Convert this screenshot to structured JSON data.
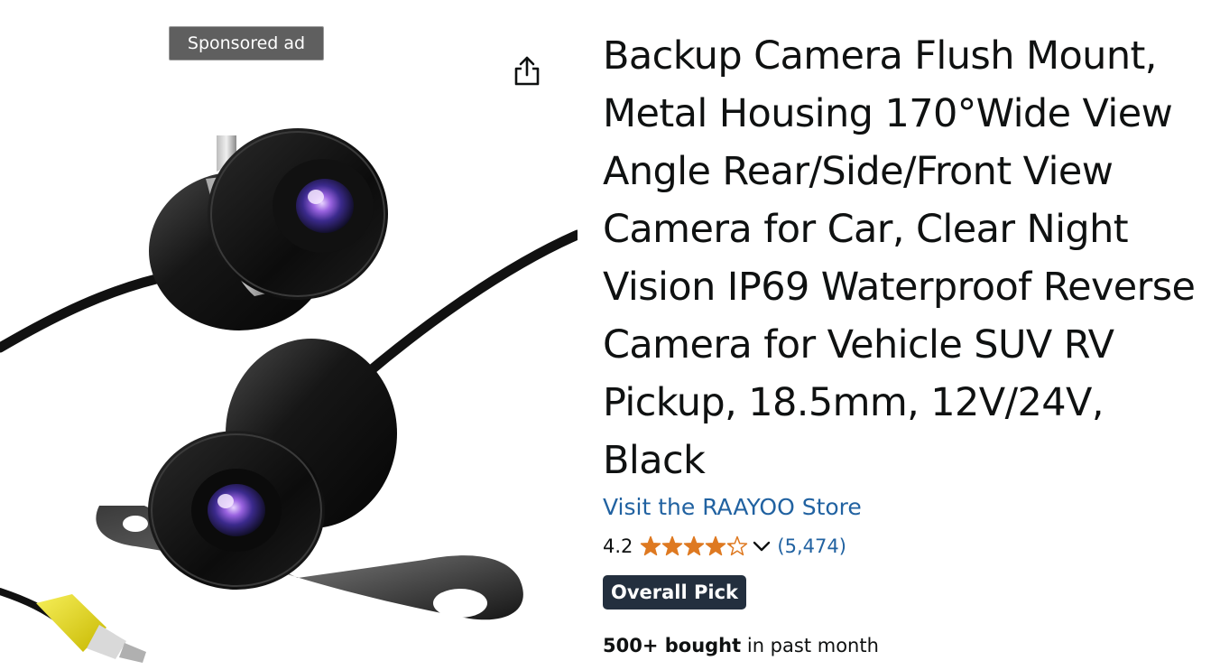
{
  "sponsored": {
    "label": "Sponsored ad"
  },
  "share": {
    "icon": "share-icon"
  },
  "product": {
    "title": "Backup Camera Flush Mount, Metal Housing 170°Wide View Angle Rear/Side/Front View Camera for Car, Clear Night Vision IP69 Waterproof Reverse Camera for Vehicle SUV RV Pickup, 18.5mm, 12V/24V, Black",
    "store_link": "Visit the RAAYOO Store",
    "rating": "4.2",
    "rating_fraction": 0.84,
    "review_count": "(5,474)",
    "badge": "Overall Pick",
    "bought_bold": "500+ bought",
    "bought_rest": " in past month"
  },
  "colors": {
    "link": "#2162a1",
    "star": "#de7921",
    "badge_bg": "#232f3e"
  }
}
